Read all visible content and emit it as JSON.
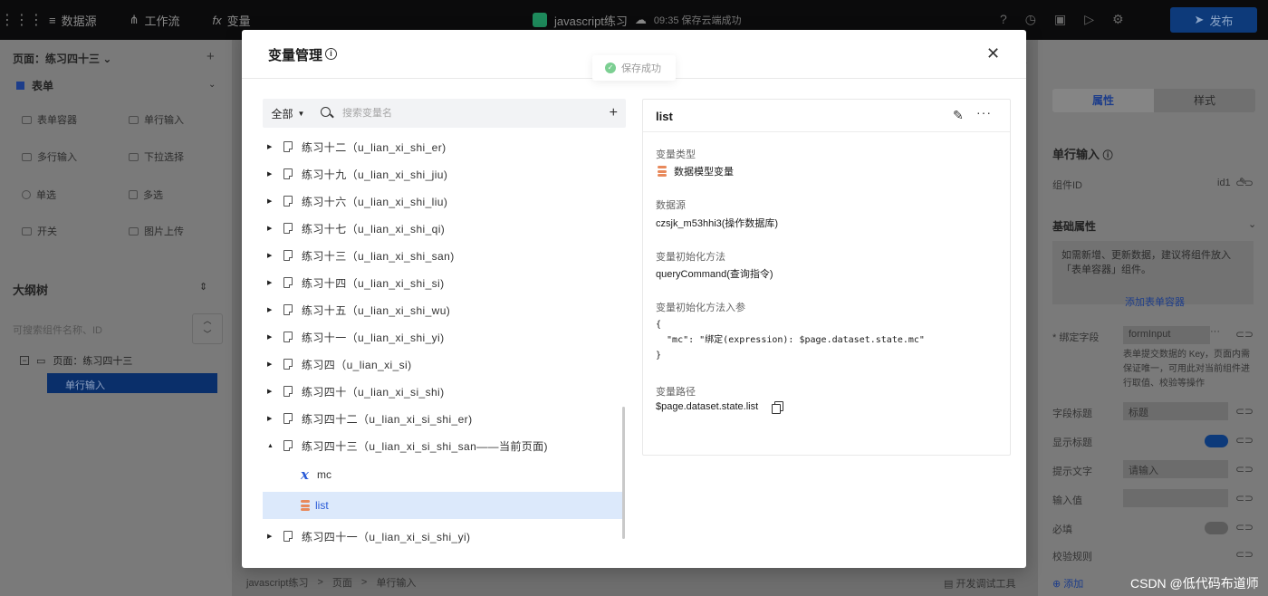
{
  "app": {
    "nav": [
      "数据源",
      "工作流",
      "变量"
    ],
    "project_title": "javascript练习",
    "save_status": "09:35 保存云端成功",
    "publish_label": "发布",
    "panel_label": "面板",
    "watermark": "CSDN @低代码布道师"
  },
  "left": {
    "page_select": "页面：练习四十三",
    "section_title": "表单",
    "components": [
      "表单容器",
      "单行输入",
      "多行输入",
      "下拉选择",
      "单选",
      "多选",
      "开关",
      "图片上传"
    ],
    "outline_title": "大纲树",
    "outline_search_placeholder": "可搜索组件名称、ID",
    "outline_nodes": [
      "页面：练习四十三",
      "单行输入"
    ]
  },
  "statusbar": {
    "crumbs": [
      "javascript练习",
      ">",
      "页面",
      ">",
      "单行输入"
    ],
    "debug_label": "开发调试工具"
  },
  "right": {
    "tabs": [
      "属性",
      "样式"
    ],
    "component_title": "单行输入",
    "id_label": "组件ID",
    "id_value": "id1",
    "basic_attr": "基础属性",
    "info_text": "如需新增、更新数据，建议将组件放入「表单容器」组件。",
    "add_form_link": "添加表单容器",
    "bind_field_label": "绑定字段",
    "bind_field_value": "formInput",
    "bind_field_desc": "表单提交数据的 Key，页面内需保证唯一，可用此对当前组件进行取值、校验等操作",
    "field_title_label": "字段标题",
    "field_title_value": "标题",
    "show_title_label": "显示标题",
    "hint_label": "提示文字",
    "hint_value": "请输入",
    "input_value_label": "输入值",
    "required_label": "必填",
    "validation_label": "校验规则",
    "add_label": "添加"
  },
  "modal": {
    "title": "变量管理",
    "toast": "保存成功",
    "filter_label": "全部",
    "search_placeholder": "搜索变量名",
    "tree": [
      {
        "label": "练习十二（u_lian_xi_shi_er)",
        "expanded": false
      },
      {
        "label": "练习十九（u_lian_xi_shi_jiu)",
        "expanded": false
      },
      {
        "label": "练习十六（u_lian_xi_shi_liu)",
        "expanded": false
      },
      {
        "label": "练习十七（u_lian_xi_shi_qi)",
        "expanded": false
      },
      {
        "label": "练习十三（u_lian_xi_shi_san)",
        "expanded": false
      },
      {
        "label": "练习十四（u_lian_xi_shi_si)",
        "expanded": false
      },
      {
        "label": "练习十五（u_lian_xi_shi_wu)",
        "expanded": false
      },
      {
        "label": "练习十一（u_lian_xi_shi_yi)",
        "expanded": false
      },
      {
        "label": "练习四（u_lian_xi_si)",
        "expanded": false
      },
      {
        "label": "练习四十（u_lian_xi_si_shi)",
        "expanded": false
      },
      {
        "label": "练习四十二（u_lian_xi_si_shi_er)",
        "expanded": false
      },
      {
        "label": "练习四十三（u_lian_xi_si_shi_san——当前页面)",
        "expanded": true
      },
      {
        "label": "练习四十一（u_lian_xi_si_shi_yi)",
        "expanded": false
      }
    ],
    "children": [
      {
        "label": "mc",
        "icon": "variable-x-icon"
      },
      {
        "label": "list",
        "icon": "database-icon",
        "selected": true
      }
    ],
    "detail": {
      "title": "list",
      "type_label": "变量类型",
      "type_value": "数据模型变量",
      "source_label": "数据源",
      "source_value": "czsjk_m53hhi3(操作数据库)",
      "init_label": "变量初始化方法",
      "init_value": "queryCommand(查询指令)",
      "params_label": "变量初始化方法入参",
      "params_code": "{\n  \"mc\": \"绑定(expression): $page.dataset.state.mc\"\n}",
      "path_label": "变量路径",
      "path_value": "$page.dataset.state.list"
    }
  }
}
